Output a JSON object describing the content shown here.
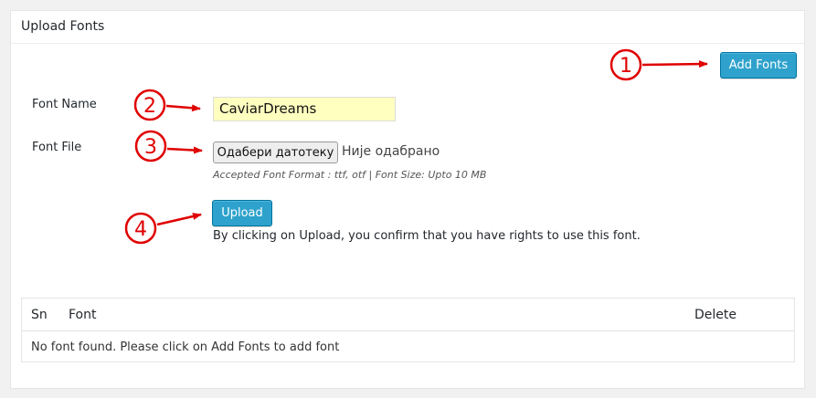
{
  "panel": {
    "title": "Upload Fonts"
  },
  "toolbar": {
    "add_fonts_label": "Add Fonts"
  },
  "form": {
    "font_name_label": "Font Name",
    "font_name_value": "CaviarDreams",
    "font_file_label": "Font File",
    "file_button_label": "Одабери датотеку",
    "file_status": "Није одабрано",
    "format_hint": "Accepted Font Format : ttf, otf | Font Size: Upto 10 MB",
    "upload_label": "Upload",
    "consent_text": "By clicking on Upload, you confirm that you have rights to use this font."
  },
  "table": {
    "columns": [
      "Sn",
      "Font",
      "Delete"
    ],
    "empty_message": "No font found. Please click on Add Fonts to add font"
  },
  "annotations": {
    "markers": [
      "1",
      "2",
      "3",
      "4"
    ],
    "color": "#e00000"
  },
  "colors": {
    "primary_button": "#2ea2cc",
    "input_highlight": "#ffffc0"
  }
}
